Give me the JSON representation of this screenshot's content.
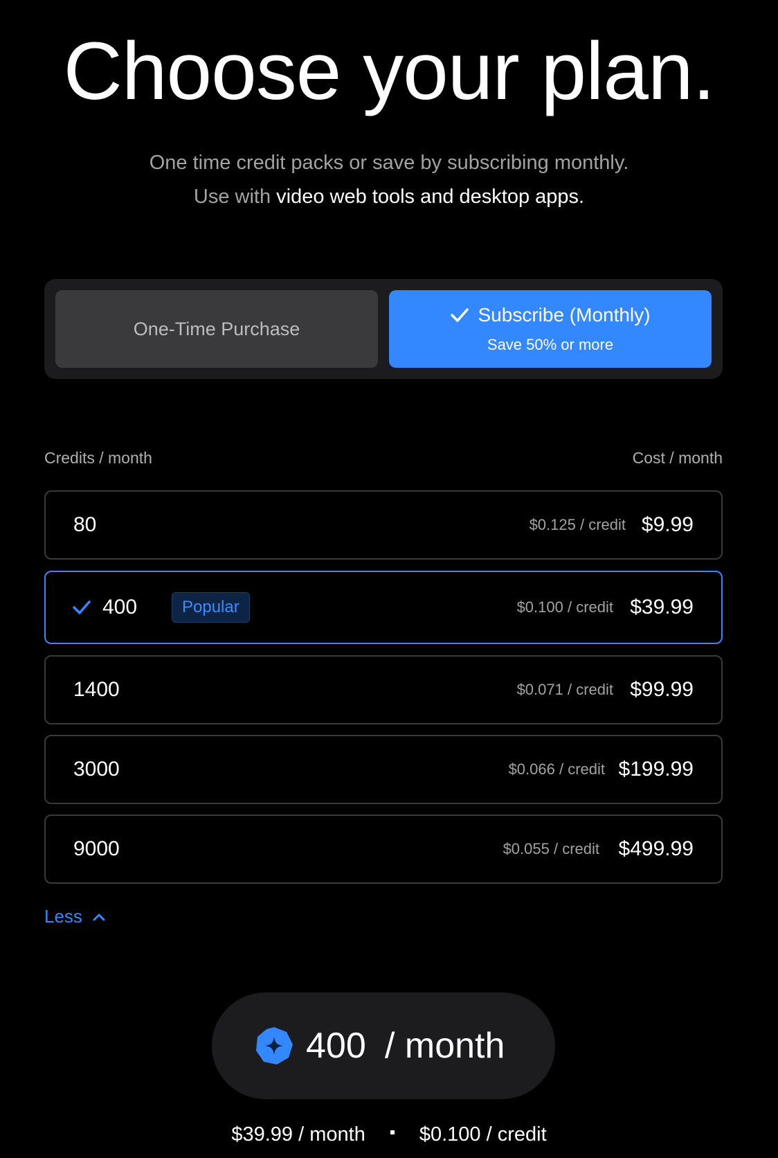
{
  "header": {
    "title": "Choose your plan.",
    "subtitle_line1": "One time credit packs or save by subscribing monthly.",
    "subtitle_line2_prefix": "Use with ",
    "subtitle_line2_highlight": "video web tools and desktop apps."
  },
  "purchase_toggle": {
    "one_time_label": "One-Time Purchase",
    "subscribe_label": "Subscribe (Monthly)",
    "subscribe_note": "Save 50% or more",
    "selected": "subscribe"
  },
  "plans": {
    "credits_header": "Credits / month",
    "cost_header": "Cost / month",
    "rows": [
      {
        "credits": "80",
        "rate": "$0.125 / credit",
        "price": "$9.99",
        "selected": false,
        "badge": ""
      },
      {
        "credits": "400",
        "rate": "$0.100 / credit",
        "price": "$39.99",
        "selected": true,
        "badge": "Popular"
      },
      {
        "credits": "1400",
        "rate": "$0.071 / credit",
        "price": "$99.99",
        "selected": false,
        "badge": ""
      },
      {
        "credits": "3000",
        "rate": "$0.066 / credit",
        "price": "$199.99",
        "selected": false,
        "badge": ""
      },
      {
        "credits": "9000",
        "rate": "$0.055 / credit",
        "price": "$499.99",
        "selected": false,
        "badge": ""
      }
    ],
    "less_label": "Less"
  },
  "summary": {
    "credits": "400",
    "unit": "/ month",
    "price": "$39.99 / month",
    "rate": "$0.100 / credit"
  },
  "colors": {
    "accent": "#3388ff",
    "background": "#000000",
    "panel": "#1c1c1e"
  },
  "icons": {
    "subscribe_check": "check-icon",
    "row_check": "check-icon",
    "less_chevron": "chevron-up-icon",
    "pill_badge": "sparkle-badge-icon"
  }
}
